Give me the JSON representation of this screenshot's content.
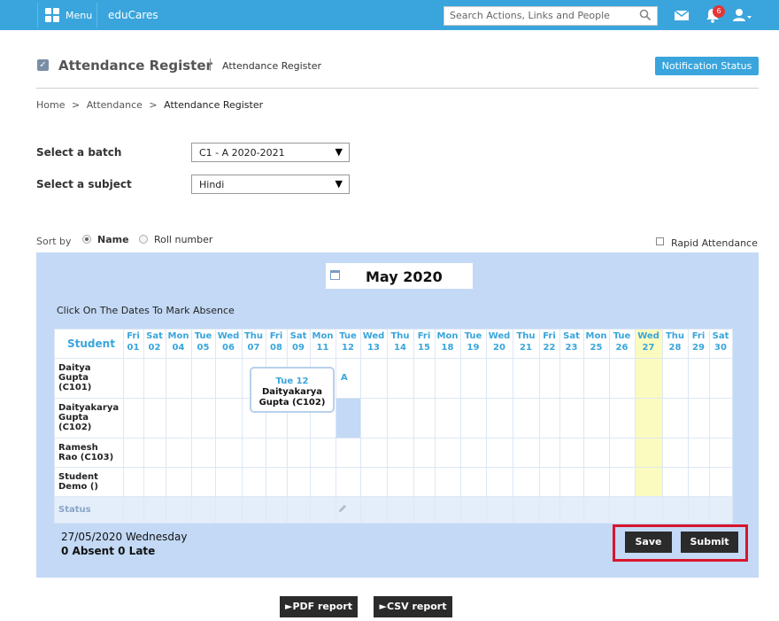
{
  "topbar": {
    "menu_label": "Menu",
    "brand": "eduCares",
    "search_placeholder": "Search Actions, Links and People",
    "notification_count": "6",
    "bg_color": "#39a5dc"
  },
  "header": {
    "title": "Attendance Register",
    "subtitle": "Attendance Register",
    "notification_button": "Notification Status"
  },
  "breadcrumb": [
    "Home",
    ">",
    "Attendance",
    ">",
    "Attendance Register"
  ],
  "form": {
    "batch_label": "Select a batch",
    "batch_value": "C1 - A 2020-2021",
    "subject_label": "Select a subject",
    "subject_value": "Hindi"
  },
  "sort": {
    "label": "Sort by",
    "options": [
      "Name",
      "Roll number"
    ],
    "selected": "Name",
    "rapid_label": "Rapid Attendance"
  },
  "calendar": {
    "month": "May 2020",
    "hint": "Click On The Dates To Mark Absence",
    "student_header": "Student",
    "days": [
      {
        "dow": "Fri",
        "d": "01"
      },
      {
        "dow": "Sat",
        "d": "02"
      },
      {
        "dow": "Mon",
        "d": "04"
      },
      {
        "dow": "Tue",
        "d": "05"
      },
      {
        "dow": "Wed",
        "d": "06"
      },
      {
        "dow": "Thu",
        "d": "07"
      },
      {
        "dow": "Fri",
        "d": "08"
      },
      {
        "dow": "Sat",
        "d": "09"
      },
      {
        "dow": "Mon",
        "d": "11"
      },
      {
        "dow": "Tue",
        "d": "12"
      },
      {
        "dow": "Wed",
        "d": "13"
      },
      {
        "dow": "Thu",
        "d": "14"
      },
      {
        "dow": "Fri",
        "d": "15"
      },
      {
        "dow": "Mon",
        "d": "18"
      },
      {
        "dow": "Tue",
        "d": "19"
      },
      {
        "dow": "Wed",
        "d": "20"
      },
      {
        "dow": "Thu",
        "d": "21"
      },
      {
        "dow": "Fri",
        "d": "22"
      },
      {
        "dow": "Sat",
        "d": "23"
      },
      {
        "dow": "Mon",
        "d": "25"
      },
      {
        "dow": "Tue",
        "d": "26"
      },
      {
        "dow": "Wed",
        "d": "27"
      },
      {
        "dow": "Thu",
        "d": "28"
      },
      {
        "dow": "Fri",
        "d": "29"
      },
      {
        "dow": "Sat",
        "d": "30"
      }
    ],
    "students": [
      {
        "lines": [
          "Daitya",
          "Gupta",
          "(C101)"
        ]
      },
      {
        "lines": [
          "Daityakarya",
          "Gupta",
          "(C102)"
        ]
      },
      {
        "lines": [
          "Ramesh",
          "Rao (C103)"
        ]
      },
      {
        "lines": [
          "Student",
          "Demo ()"
        ]
      }
    ],
    "absent_mark": "A",
    "status_label": "Status",
    "tooltip_date": "Tue 12",
    "tooltip_name_1": "Daityakarya",
    "tooltip_name_2": "Gupta (C102)",
    "highlight_color": "#fbfbbf"
  },
  "summary": {
    "date": "27/05/2020 Wednesday",
    "counts": "0 Absent  0 Late"
  },
  "actions": {
    "save": "Save",
    "submit": "Submit",
    "pdf": "►PDF report",
    "csv": "►CSV report"
  }
}
